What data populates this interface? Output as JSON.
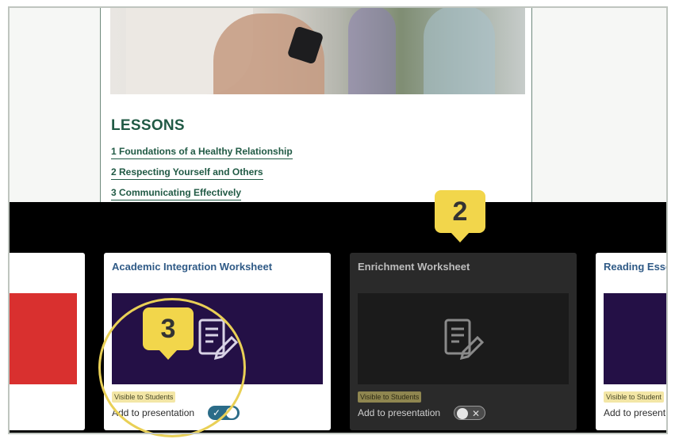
{
  "lessons": {
    "title": "LESSONS",
    "items": [
      "1 Foundations of a Healthy Relationship",
      "2 Respecting Yourself and Others",
      "3 Communicating Effectively"
    ]
  },
  "cards": [
    {
      "title": "Academic Integration Worksheet",
      "visibility": "Visible to Students",
      "add_label": "Add to presentation",
      "toggle_on": true,
      "toggle_mark": "✓"
    },
    {
      "title": "Enrichment Worksheet",
      "visibility": "Visible to Students",
      "add_label": "Add to presentation",
      "toggle_on": false,
      "toggle_mark": "✕"
    },
    {
      "title": "Reading Esse",
      "visibility": "Visible to Student",
      "add_label": "Add to present"
    }
  ],
  "callouts": {
    "two": "2",
    "three": "3"
  },
  "colors": {
    "lesson_green": "#215a45",
    "card_title_blue": "#2f5a86",
    "thumb_purple": "#241046",
    "toggle_on": "#2b6c88",
    "callout_yellow": "#f2d64b",
    "badge_yellow": "#f3e6a6"
  },
  "icons": {
    "worksheet": "document-edit-icon"
  }
}
